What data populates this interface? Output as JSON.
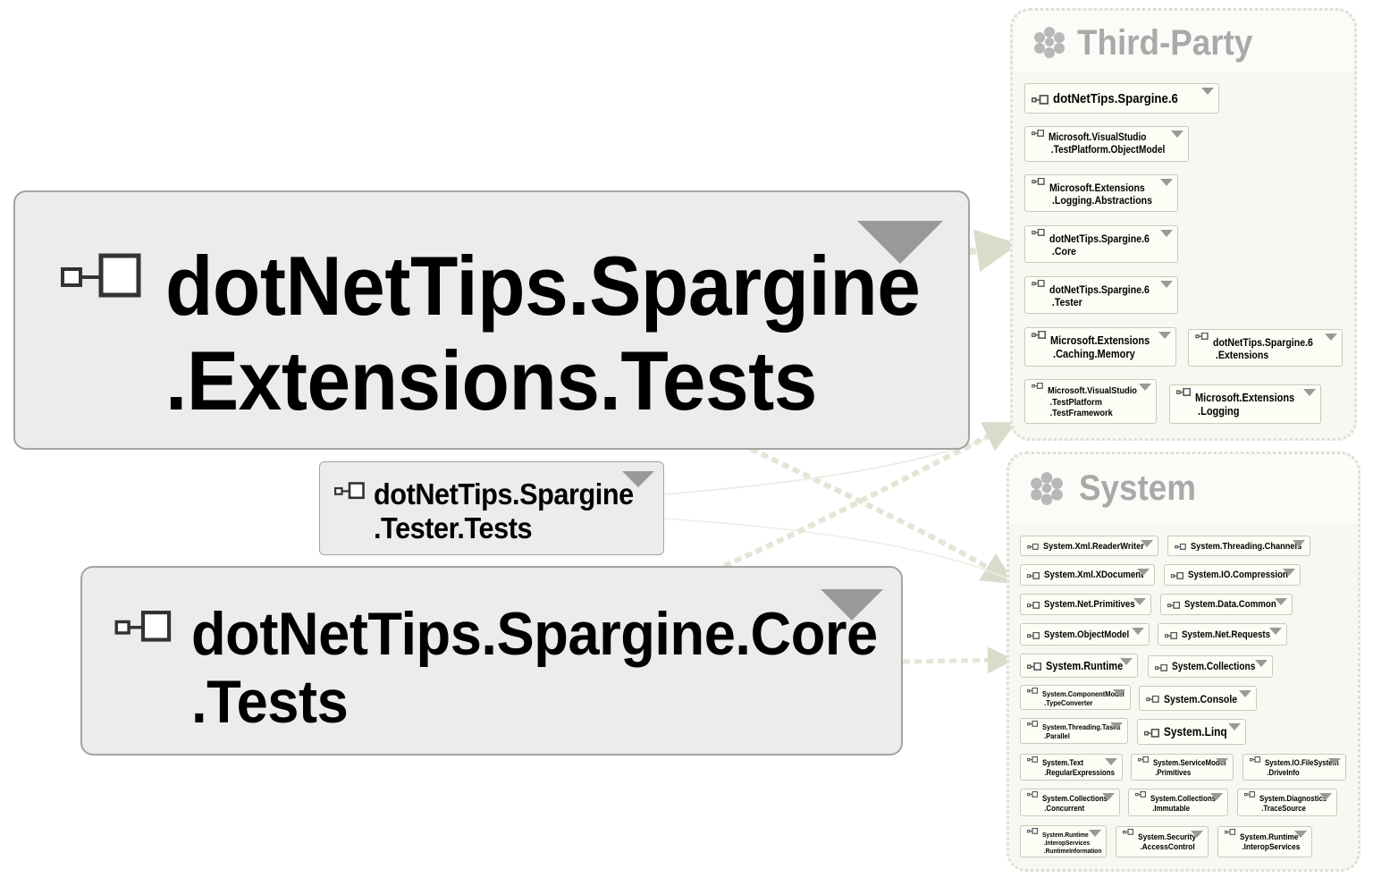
{
  "nodes": {
    "extensions_tests": {
      "line1": "dotNetTips.Spargine",
      "line2": ".Extensions.Tests"
    },
    "tester_tests": {
      "line1": "dotNetTips.Spargine",
      "line2": ".Tester.Tests"
    },
    "core_tests": {
      "line1": "dotNetTips.Spargine.Core",
      "line2": ".Tests"
    }
  },
  "groups": {
    "third_party": {
      "title": "Third-Party",
      "items": [
        {
          "label": "dotNetTips.Spargine.6"
        },
        {
          "label": "Microsoft.VisualStudio\n .TestPlatform.ObjectModel"
        },
        {
          "label": "Microsoft.Extensions\n .Logging.Abstractions"
        },
        {
          "label": "dotNetTips.Spargine.6\n .Core"
        },
        {
          "label": "dotNetTips.Spargine.6\n .Tester"
        },
        {
          "label": "Microsoft.Extensions\n .Caching.Memory"
        },
        {
          "label": "dotNetTips.Spargine.6\n .Extensions"
        },
        {
          "label": "Microsoft.VisualStudio\n .TestPlatform\n .TestFramework"
        },
        {
          "label": "Microsoft.Extensions\n .Logging"
        }
      ]
    },
    "system": {
      "title": "System",
      "items": [
        {
          "label": "System.Xml.ReaderWriter"
        },
        {
          "label": "System.Threading.Channels"
        },
        {
          "label": "System.Xml.XDocument"
        },
        {
          "label": "System.IO.Compression"
        },
        {
          "label": "System.Net.Primitives"
        },
        {
          "label": "System.Data.Common"
        },
        {
          "label": "System.ObjectModel"
        },
        {
          "label": "System.Net.Requests"
        },
        {
          "label": "System.Runtime"
        },
        {
          "label": "System.Collections"
        },
        {
          "label": "System.ComponentModel\n .TypeConverter"
        },
        {
          "label": "System.Console"
        },
        {
          "label": "System.Threading.Tasks\n .Parallel"
        },
        {
          "label": "System.Linq"
        },
        {
          "label": "System.Text\n .RegularExpressions"
        },
        {
          "label": "System.ServiceModel\n .Primitives"
        },
        {
          "label": "System.IO.FileSystem\n .DriveInfo"
        },
        {
          "label": "System.Collections\n .Concurrent"
        },
        {
          "label": "System.Collections\n .Immutable"
        },
        {
          "label": "System.Diagnostics\n .TraceSource"
        },
        {
          "label": "System.Runtime\n .InteropServices\n .RuntimeInformation"
        },
        {
          "label": "System.Security\n .AccessControl"
        },
        {
          "label": "System.Runtime\n .InteropServices"
        }
      ]
    }
  },
  "icons": {
    "assembly": "assembly-icon",
    "group": "cluster-icon"
  },
  "colors": {
    "edge": "#e3e6d5",
    "node_bg": "#ececec",
    "group_bg": "#f7f8f2",
    "chip_bg": "#fdfdf5"
  }
}
